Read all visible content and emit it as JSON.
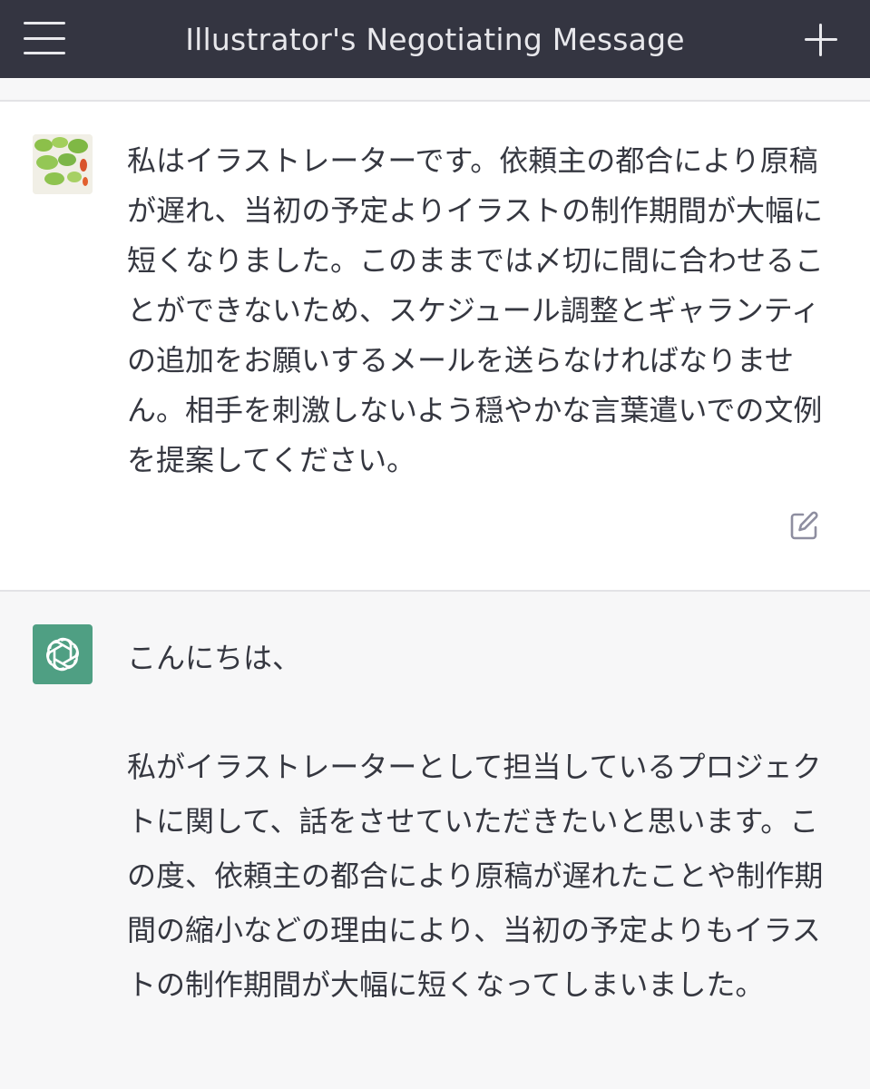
{
  "header": {
    "title": "Illustrator's Negotiating Message",
    "menu_icon": "hamburger-menu-icon",
    "new_chat_icon": "plus-icon"
  },
  "conversation": {
    "user_message": {
      "avatar": "lily-pad-koi-avatar",
      "text": "私はイラストレーターです。依頼主の都合により原稿が遅れ、当初の予定よりイラストの制作期間が大幅に短くなりました。このままでは〆切に間に合わせることができないため、スケジュール調整とギャランティの追加をお願いするメールを送らなければなりません。相手を刺激しないよう穏やかな言葉遣いでの文例を提案してください。",
      "edit_icon": "edit-icon"
    },
    "assistant_message": {
      "avatar": "openai-logo-icon",
      "greeting": "こんにちは、",
      "body": "私がイラストレーターとして担当しているプロジェクトに関して、話をさせていただきたいと思います。この度、依頼主の都合により原稿が遅れたことや制作期間の縮小などの理由により、当初の予定よりもイラストの制作期間が大幅に短くなってしまいました。"
    }
  },
  "colors": {
    "topbar_bg": "#343541",
    "assistant_bg": "#f7f7f8",
    "brand_green": "#4f9f83",
    "text": "#353740"
  }
}
